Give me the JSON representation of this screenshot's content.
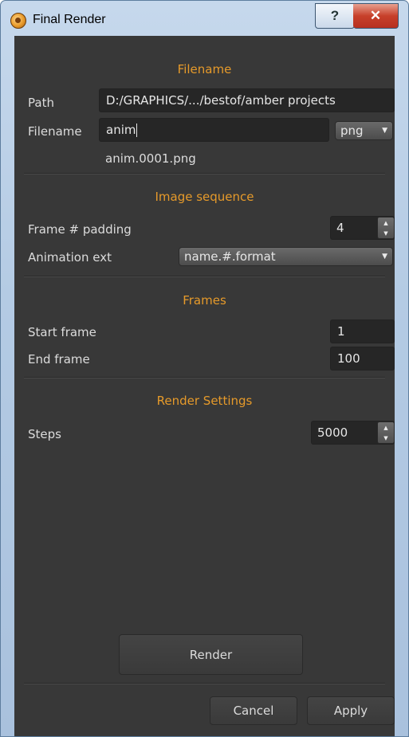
{
  "window": {
    "title": "Final Render",
    "help_label": "?",
    "close_label": "✕"
  },
  "filename_section": {
    "title": "Filename",
    "path_label": "Path",
    "path_value": "D:/GRAPHICS/.../bestof/amber projects",
    "filename_label": "Filename",
    "filename_value": "anim",
    "format_value": "png",
    "preview": "anim.0001.png"
  },
  "sequence_section": {
    "title": "Image sequence",
    "padding_label": "Frame # padding",
    "padding_value": "4",
    "ext_label": "Animation ext",
    "ext_value": "name.#.format"
  },
  "frames_section": {
    "title": "Frames",
    "start_label": "Start frame",
    "start_value": "1",
    "end_label": "End frame",
    "end_value": "100"
  },
  "render_section": {
    "title": "Render Settings",
    "steps_label": "Steps",
    "steps_value": "5000"
  },
  "buttons": {
    "render": "Render",
    "cancel": "Cancel",
    "apply": "Apply"
  },
  "colors": {
    "accent": "#e69a2a",
    "panel": "#383838",
    "field": "#262626"
  }
}
